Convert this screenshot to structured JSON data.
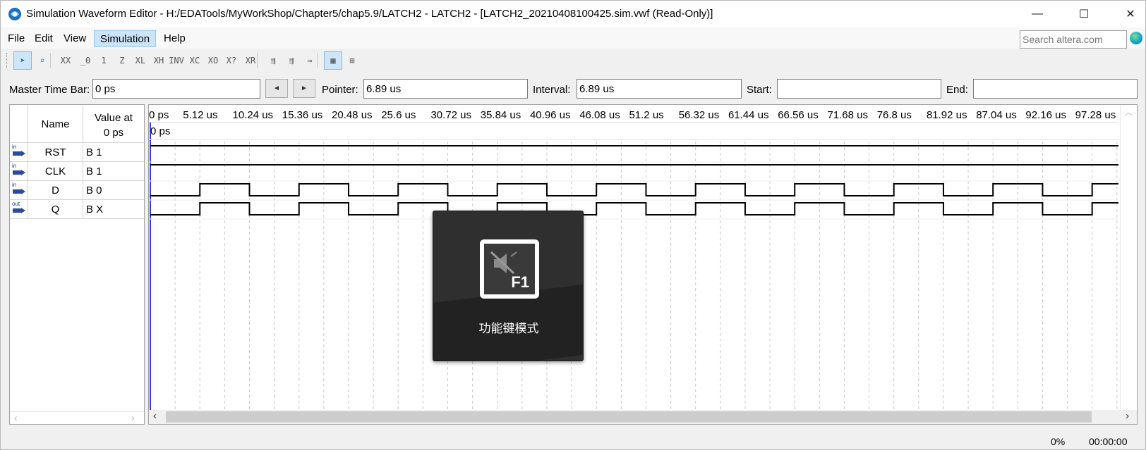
{
  "window": {
    "title": "Simulation Waveform Editor - H:/EDATools/MyWorkShop/Chapter5/chap5.9/LATCH2 - LATCH2 - [LATCH2_20210408100425.sim.vwf (Read-Only)]",
    "minimize": "—",
    "maximize": "☐",
    "close": "✕"
  },
  "menu": {
    "items": [
      "File",
      "Edit",
      "View",
      "Simulation",
      "Help"
    ],
    "active": "Simulation",
    "search_placeholder": "Search altera.com"
  },
  "toolbar": {
    "buttons": [
      {
        "name": "selection-tool",
        "icon": "arrow-pointer-icon",
        "glyph": "➤",
        "selected": true
      },
      {
        "name": "zoom-tool",
        "icon": "magnifier-icon",
        "glyph": "⌕",
        "selected": false
      },
      {
        "name": "force-unknown",
        "icon": "xx-icon",
        "glyph": "XX"
      },
      {
        "name": "force-low",
        "icon": "zero-icon",
        "glyph": "_0"
      },
      {
        "name": "force-high",
        "icon": "one-icon",
        "glyph": "1"
      },
      {
        "name": "force-high-impedance",
        "icon": "z-icon",
        "glyph": "Z"
      },
      {
        "name": "force-weak-low",
        "icon": "weak-low-icon",
        "glyph": "XL"
      },
      {
        "name": "force-weak-high",
        "icon": "weak-high-icon",
        "glyph": "XH"
      },
      {
        "name": "invert",
        "icon": "invert-icon",
        "glyph": "INV"
      },
      {
        "name": "count-value",
        "icon": "count-icon",
        "glyph": "XC"
      },
      {
        "name": "overwrite-clock",
        "icon": "clock-icon",
        "glyph": "XO"
      },
      {
        "name": "arbitrary-value",
        "icon": "arbitrary-icon",
        "glyph": "X?"
      },
      {
        "name": "random-values",
        "icon": "random-icon",
        "glyph": "XR"
      },
      {
        "name": "run-functional-sim",
        "icon": "functional-sim-icon",
        "glyph": "⇶"
      },
      {
        "name": "run-timing-sim",
        "icon": "timing-sim-icon",
        "glyph": "⇶"
      },
      {
        "name": "generate-testbench",
        "icon": "testbench-icon",
        "glyph": "⇝"
      },
      {
        "name": "snap-to-grid",
        "icon": "grid-icon",
        "glyph": "▦",
        "selected": true
      },
      {
        "name": "grid-settings",
        "icon": "grid-settings-icon",
        "glyph": "⊞"
      }
    ]
  },
  "timebar": {
    "master_label": "Master Time Bar:",
    "master_value": "0 ps",
    "prev_glyph": "◄",
    "next_glyph": "►",
    "pointer_label": "Pointer:",
    "pointer_value": "6.89 us",
    "interval_label": "Interval:",
    "interval_value": "6.89 us",
    "start_label": "Start:",
    "start_value": "",
    "end_label": "End:",
    "end_value": ""
  },
  "name_panel": {
    "header_name": "Name",
    "header_value_line1": "Value at",
    "header_value_line2": "0 ps",
    "signals": [
      {
        "name": "RST",
        "value": "B 1",
        "direction": "in"
      },
      {
        "name": "CLK",
        "value": "B 1",
        "direction": "in"
      },
      {
        "name": "D",
        "value": "B 0",
        "direction": "in"
      },
      {
        "name": "Q",
        "value": "B X",
        "direction": "out"
      }
    ]
  },
  "wave_panel": {
    "ticks": [
      "0 ps",
      "5.12 us",
      "10.24 us",
      "15.36 us",
      "20.48 us",
      "25.6 us",
      "30.72 us",
      "35.84 us",
      "40.96 us",
      "46.08 us",
      "51.2 us",
      "56.32 us",
      "61.44 us",
      "66.56 us",
      "71.68 us",
      "76.8 us",
      "81.92 us",
      "87.04 us",
      "92.16 us",
      "97.28 us"
    ],
    "cursor_label": "0 ps",
    "waves": {
      "RST": {
        "type": "constant",
        "level": 1
      },
      "CLK": {
        "type": "constant",
        "level": 1
      },
      "D": {
        "type": "clock",
        "start_level": 0,
        "half_period_us": 5.12
      },
      "Q": {
        "type": "clock",
        "start_level": 0,
        "half_period_us": 5.12
      }
    },
    "time_span_us": 100.0
  },
  "overlay": {
    "key_text": "F1",
    "caption": "功能键模式"
  },
  "status": {
    "percent": "0%",
    "elapsed": "00:00:00"
  }
}
